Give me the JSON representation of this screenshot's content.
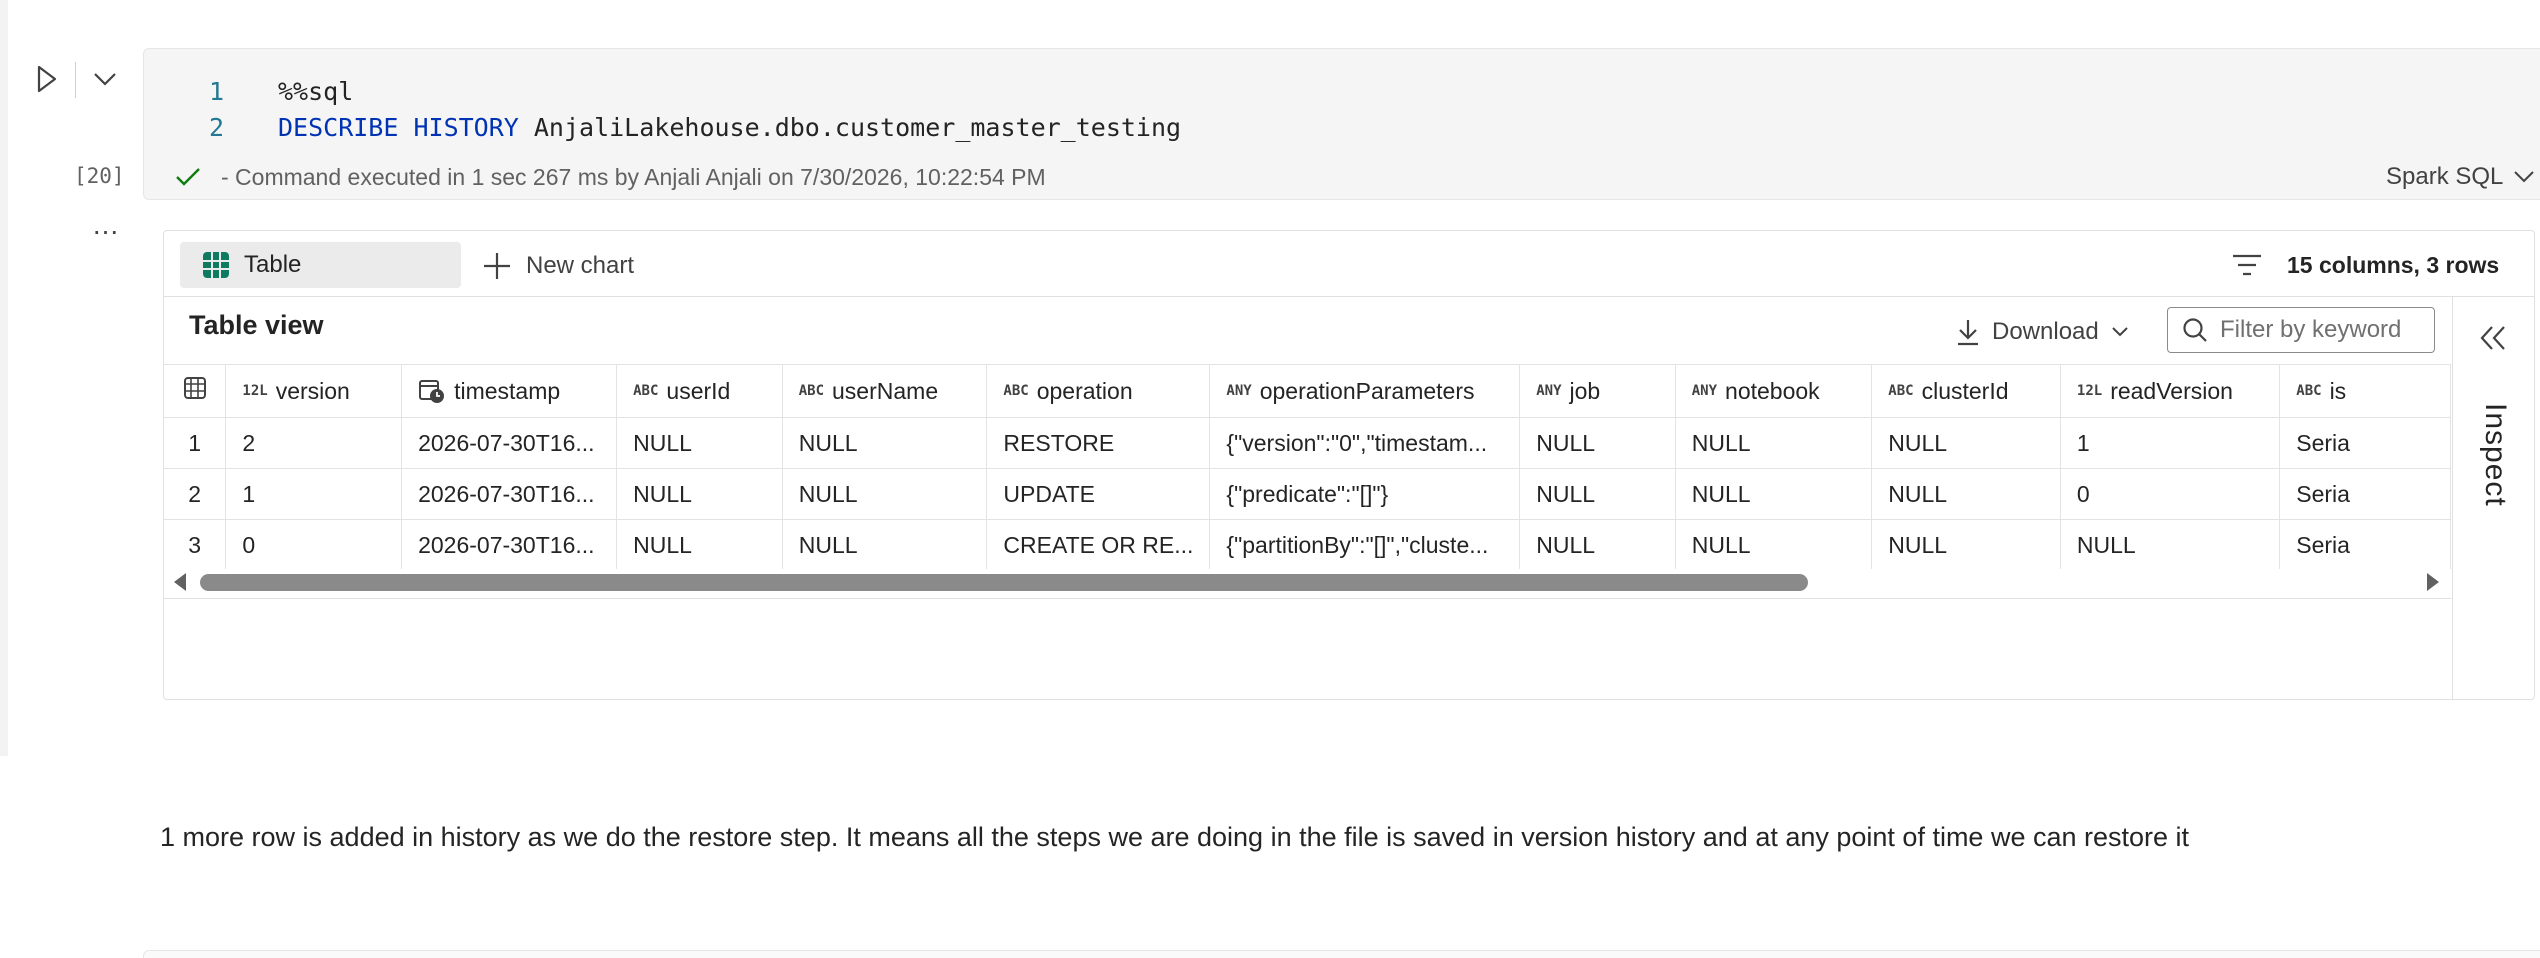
{
  "cell": {
    "execution_count": "[20]",
    "more_label": "...",
    "code_lines": [
      {
        "number": "1",
        "text": "%%sql"
      },
      {
        "number": "2",
        "keyword": "DESCRIBE HISTORY",
        "rest": " AnjaliLakehouse.dbo.customer_master_testing"
      }
    ],
    "status_text": "- Command executed in 1 sec 267 ms by Anjali Anjali on 7/30/2026, 10:22:54 PM",
    "status_color": "#107c10",
    "language": "Spark SQL"
  },
  "output": {
    "table_tab_label": "Table",
    "new_chart_label": "New chart",
    "summary": "15 columns, 3 rows",
    "table_view_title": "Table view",
    "download_label": "Download",
    "filter_placeholder": "Filter by keyword",
    "inspect_label": "Inspect",
    "columns": [
      {
        "type": "12L",
        "name": "version"
      },
      {
        "type": "clock-icon",
        "name": "timestamp"
      },
      {
        "type": "ABC",
        "name": "userId"
      },
      {
        "type": "ABC",
        "name": "userName"
      },
      {
        "type": "ABC",
        "name": "operation"
      },
      {
        "type": "ANY",
        "name": "operationParameters"
      },
      {
        "type": "ANY",
        "name": "job"
      },
      {
        "type": "ANY",
        "name": "notebook"
      },
      {
        "type": "ABC",
        "name": "clusterId"
      },
      {
        "type": "12L",
        "name": "readVersion"
      },
      {
        "type": "ABC",
        "name": "is"
      }
    ],
    "rows": [
      {
        "n": "1",
        "cells": [
          "2",
          "2026-07-30T16...",
          "NULL",
          "NULL",
          "RESTORE",
          "{\"version\":\"0\",\"timestam...",
          "NULL",
          "NULL",
          "NULL",
          "1",
          "Seria"
        ]
      },
      {
        "n": "2",
        "cells": [
          "1",
          "2026-07-30T16...",
          "NULL",
          "NULL",
          "UPDATE",
          "{\"predicate\":\"[]\"}",
          "NULL",
          "NULL",
          "NULL",
          "0",
          "Seria"
        ]
      },
      {
        "n": "3",
        "cells": [
          "0",
          "2026-07-30T16...",
          "NULL",
          "NULL",
          "CREATE OR RE...",
          "{\"partitionBy\":\"[]\",\"cluste...",
          "NULL",
          "NULL",
          "NULL",
          "NULL",
          "Seria"
        ]
      }
    ]
  },
  "markdown": {
    "text": "1 more row is added in history as we do the restore step. It means all the steps we are doing in the file is saved in version history and at any point of time we can restore it"
  }
}
